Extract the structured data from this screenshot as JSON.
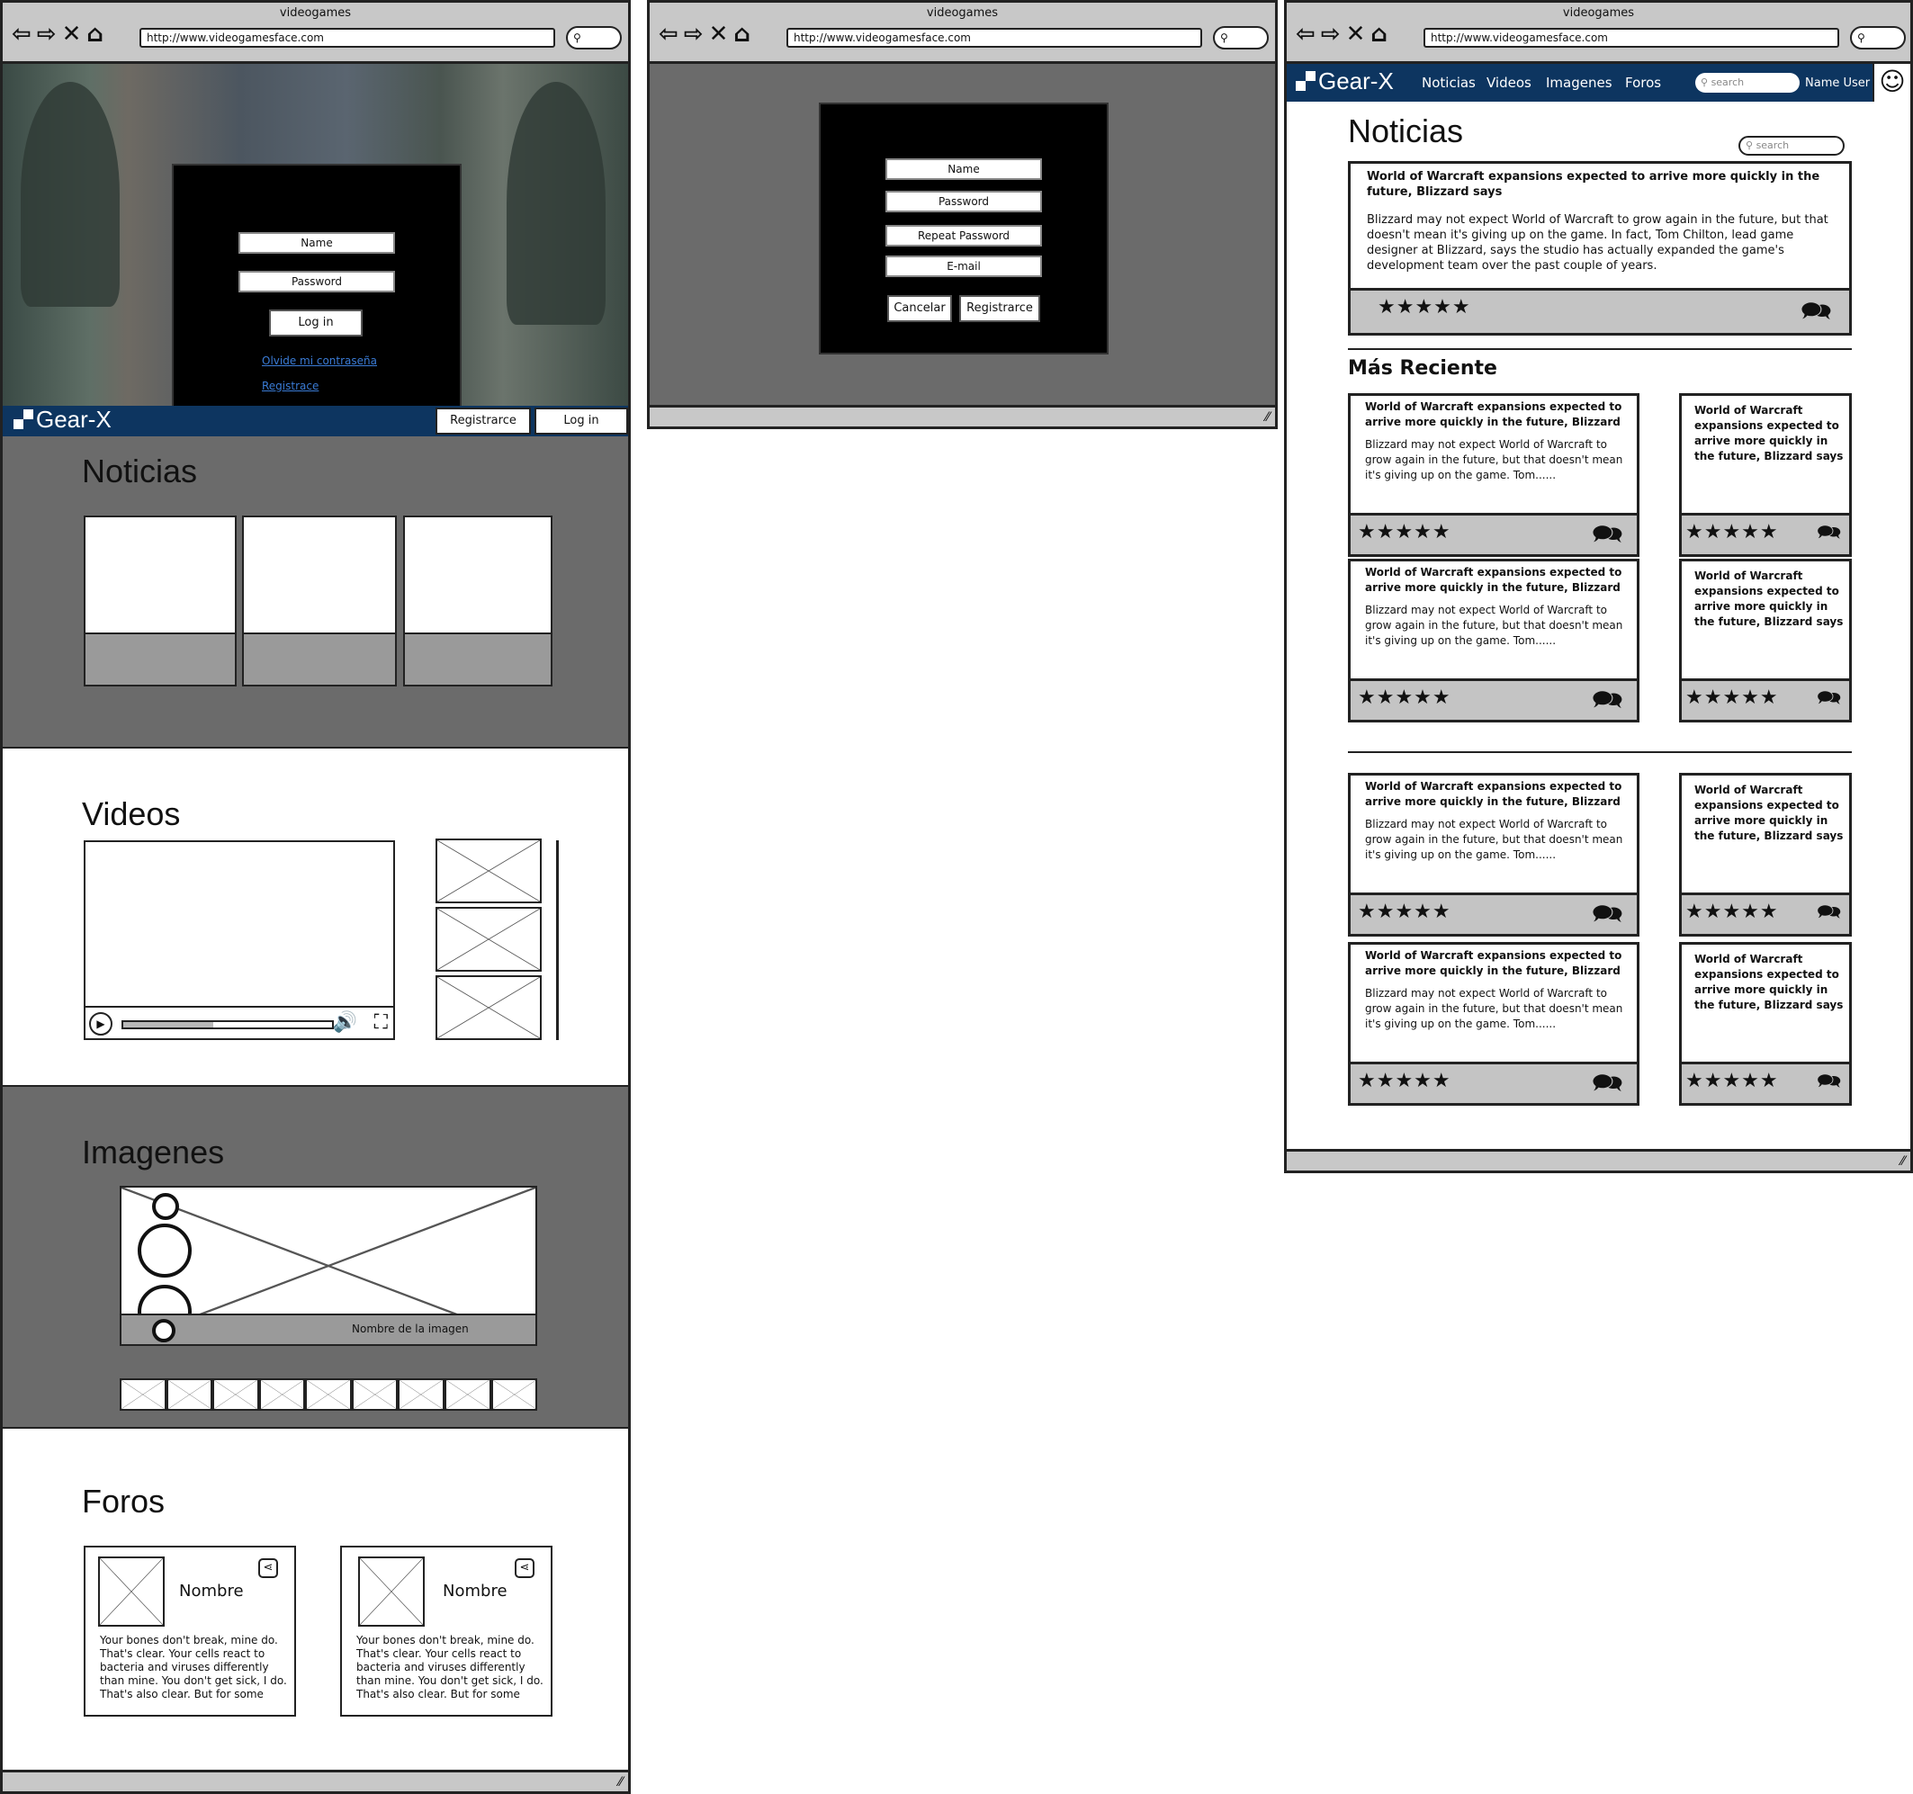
{
  "browser": {
    "title": "videogames",
    "url": "http://www.videogamesface.com"
  },
  "landing": {
    "login": {
      "name_placeholder": "Name",
      "password_placeholder": "Password",
      "login_button": "Log in",
      "forgot_link": "Olvide mi contraseña",
      "register_link": "Registrace"
    },
    "topbar": {
      "logo": "Gear-X",
      "register_button": "Registrarce",
      "login_button": "Log in"
    },
    "sections": {
      "noticias": "Noticias",
      "videos": "Videos",
      "imagenes": "Imagenes",
      "foros": "Foros"
    },
    "video_progress": 0.43,
    "image_caption": "Nombre de la imagen",
    "forums": [
      {
        "name": "Nombre",
        "text": "Your bones don't break, mine do. That's clear. Your cells react to bacteria and viruses differently than mine. You don't get sick, I do. That's also clear. But for some"
      },
      {
        "name": "Nombre",
        "text": "Your bones don't break, mine do. That's clear. Your cells react to bacteria and viruses differently than mine. You don't get sick, I do. That's also clear. But for some"
      }
    ]
  },
  "register": {
    "name_placeholder": "Name",
    "password_placeholder": "Password",
    "repeat_password_placeholder": "Repeat Password",
    "email_placeholder": "E-mail",
    "cancel_button": "Cancelar",
    "register_button": "Registrarce"
  },
  "news_page": {
    "logo": "Gear-X",
    "nav": [
      "Noticias",
      "Videos",
      "Imagenes",
      "Foros"
    ],
    "nav_search_placeholder": "search",
    "user_name": "Name User",
    "title": "Noticias",
    "search_placeholder": "search",
    "featured": {
      "title": "World of Warcraft expansions expected to arrive more quickly in the future, Blizzard says",
      "body": "Blizzard may not expect World of Warcraft to grow again in the future, but that doesn't mean it's giving up on the game. In fact, Tom Chilton, lead game designer at Blizzard, says the studio has actually expanded the game's development team over the past couple of years.",
      "rating": 5
    },
    "recent_title": "Más Reciente",
    "wide_card": {
      "title": "World of Warcraft expansions expected to arrive more quickly in the future, Blizzard",
      "body": "Blizzard may not expect World of Warcraft to grow again in the future, but that doesn't mean it's giving up on the game. Tom......"
    },
    "narrow_card": {
      "title": "World of Warcraft expansions expected to arrive more quickly in the future, Blizzard says"
    },
    "stars": "★★★★★",
    "icons": {
      "chat": "chat-bubbles-icon",
      "star": "star-icon"
    }
  }
}
